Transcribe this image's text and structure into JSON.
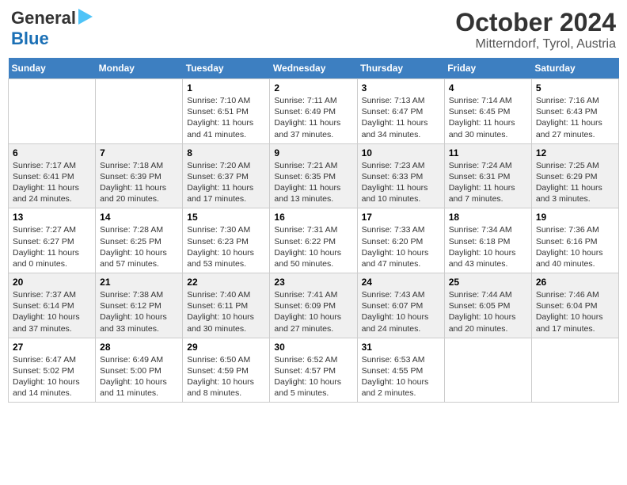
{
  "header": {
    "logo_line1": "General",
    "logo_line2": "Blue",
    "title": "October 2024",
    "subtitle": "Mitterndorf, Tyrol, Austria"
  },
  "days_of_week": [
    "Sunday",
    "Monday",
    "Tuesday",
    "Wednesday",
    "Thursday",
    "Friday",
    "Saturday"
  ],
  "weeks": [
    [
      {
        "day": "",
        "info": ""
      },
      {
        "day": "",
        "info": ""
      },
      {
        "day": "1",
        "info": "Sunrise: 7:10 AM\nSunset: 6:51 PM\nDaylight: 11 hours and 41 minutes."
      },
      {
        "day": "2",
        "info": "Sunrise: 7:11 AM\nSunset: 6:49 PM\nDaylight: 11 hours and 37 minutes."
      },
      {
        "day": "3",
        "info": "Sunrise: 7:13 AM\nSunset: 6:47 PM\nDaylight: 11 hours and 34 minutes."
      },
      {
        "day": "4",
        "info": "Sunrise: 7:14 AM\nSunset: 6:45 PM\nDaylight: 11 hours and 30 minutes."
      },
      {
        "day": "5",
        "info": "Sunrise: 7:16 AM\nSunset: 6:43 PM\nDaylight: 11 hours and 27 minutes."
      }
    ],
    [
      {
        "day": "6",
        "info": "Sunrise: 7:17 AM\nSunset: 6:41 PM\nDaylight: 11 hours and 24 minutes."
      },
      {
        "day": "7",
        "info": "Sunrise: 7:18 AM\nSunset: 6:39 PM\nDaylight: 11 hours and 20 minutes."
      },
      {
        "day": "8",
        "info": "Sunrise: 7:20 AM\nSunset: 6:37 PM\nDaylight: 11 hours and 17 minutes."
      },
      {
        "day": "9",
        "info": "Sunrise: 7:21 AM\nSunset: 6:35 PM\nDaylight: 11 hours and 13 minutes."
      },
      {
        "day": "10",
        "info": "Sunrise: 7:23 AM\nSunset: 6:33 PM\nDaylight: 11 hours and 10 minutes."
      },
      {
        "day": "11",
        "info": "Sunrise: 7:24 AM\nSunset: 6:31 PM\nDaylight: 11 hours and 7 minutes."
      },
      {
        "day": "12",
        "info": "Sunrise: 7:25 AM\nSunset: 6:29 PM\nDaylight: 11 hours and 3 minutes."
      }
    ],
    [
      {
        "day": "13",
        "info": "Sunrise: 7:27 AM\nSunset: 6:27 PM\nDaylight: 11 hours and 0 minutes."
      },
      {
        "day": "14",
        "info": "Sunrise: 7:28 AM\nSunset: 6:25 PM\nDaylight: 10 hours and 57 minutes."
      },
      {
        "day": "15",
        "info": "Sunrise: 7:30 AM\nSunset: 6:23 PM\nDaylight: 10 hours and 53 minutes."
      },
      {
        "day": "16",
        "info": "Sunrise: 7:31 AM\nSunset: 6:22 PM\nDaylight: 10 hours and 50 minutes."
      },
      {
        "day": "17",
        "info": "Sunrise: 7:33 AM\nSunset: 6:20 PM\nDaylight: 10 hours and 47 minutes."
      },
      {
        "day": "18",
        "info": "Sunrise: 7:34 AM\nSunset: 6:18 PM\nDaylight: 10 hours and 43 minutes."
      },
      {
        "day": "19",
        "info": "Sunrise: 7:36 AM\nSunset: 6:16 PM\nDaylight: 10 hours and 40 minutes."
      }
    ],
    [
      {
        "day": "20",
        "info": "Sunrise: 7:37 AM\nSunset: 6:14 PM\nDaylight: 10 hours and 37 minutes."
      },
      {
        "day": "21",
        "info": "Sunrise: 7:38 AM\nSunset: 6:12 PM\nDaylight: 10 hours and 33 minutes."
      },
      {
        "day": "22",
        "info": "Sunrise: 7:40 AM\nSunset: 6:11 PM\nDaylight: 10 hours and 30 minutes."
      },
      {
        "day": "23",
        "info": "Sunrise: 7:41 AM\nSunset: 6:09 PM\nDaylight: 10 hours and 27 minutes."
      },
      {
        "day": "24",
        "info": "Sunrise: 7:43 AM\nSunset: 6:07 PM\nDaylight: 10 hours and 24 minutes."
      },
      {
        "day": "25",
        "info": "Sunrise: 7:44 AM\nSunset: 6:05 PM\nDaylight: 10 hours and 20 minutes."
      },
      {
        "day": "26",
        "info": "Sunrise: 7:46 AM\nSunset: 6:04 PM\nDaylight: 10 hours and 17 minutes."
      }
    ],
    [
      {
        "day": "27",
        "info": "Sunrise: 6:47 AM\nSunset: 5:02 PM\nDaylight: 10 hours and 14 minutes."
      },
      {
        "day": "28",
        "info": "Sunrise: 6:49 AM\nSunset: 5:00 PM\nDaylight: 10 hours and 11 minutes."
      },
      {
        "day": "29",
        "info": "Sunrise: 6:50 AM\nSunset: 4:59 PM\nDaylight: 10 hours and 8 minutes."
      },
      {
        "day": "30",
        "info": "Sunrise: 6:52 AM\nSunset: 4:57 PM\nDaylight: 10 hours and 5 minutes."
      },
      {
        "day": "31",
        "info": "Sunrise: 6:53 AM\nSunset: 4:55 PM\nDaylight: 10 hours and 2 minutes."
      },
      {
        "day": "",
        "info": ""
      },
      {
        "day": "",
        "info": ""
      }
    ]
  ]
}
